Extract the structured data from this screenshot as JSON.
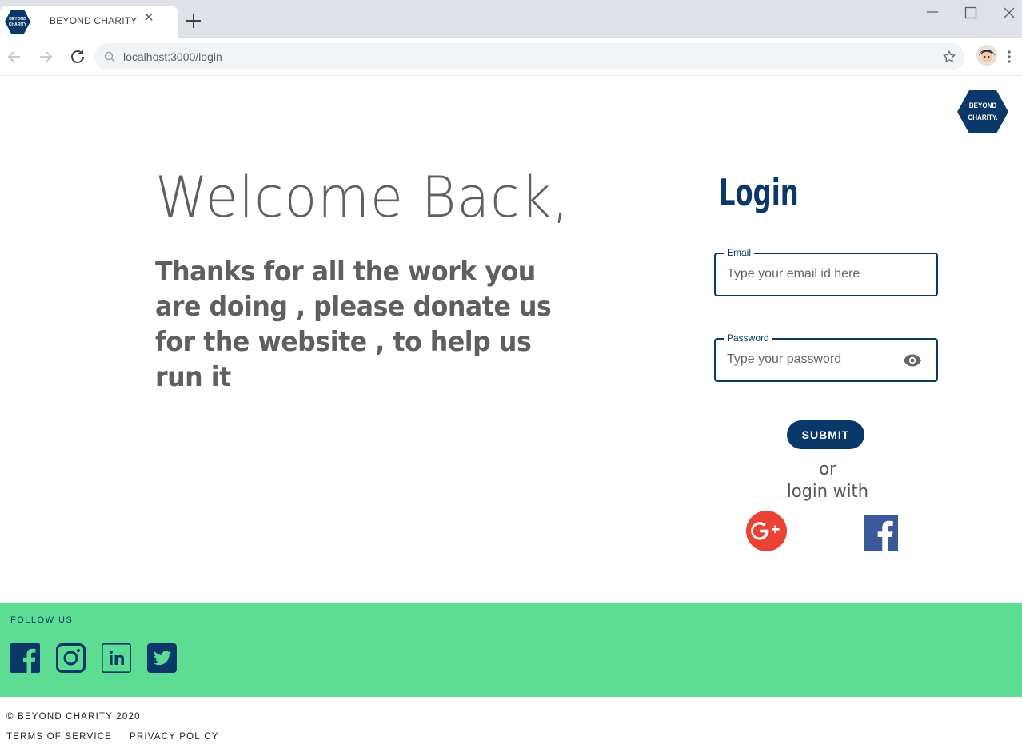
{
  "browser": {
    "tab_title": "BEYOND CHARITY",
    "tab_close": "✕",
    "favicon_text": [
      "BEYOND",
      "CHARITY"
    ],
    "url": "localhost:3000/login"
  },
  "brand": {
    "logo_line1": "BEYOND",
    "logo_line2": "CHARITY."
  },
  "hero": {
    "heading": "Welcome Back,",
    "message": "Thanks for all the work you are doing , please donate us for the website , to help us run it"
  },
  "login": {
    "title": "Login",
    "email_label": "Email",
    "email_placeholder": "Type your email id here",
    "password_label": "Password",
    "password_placeholder": "Type your password",
    "submit_label": "SUBMIT",
    "or_text": "or",
    "login_with_text": "login with"
  },
  "footer": {
    "follow_label": "FOLLOW US",
    "socials": [
      "facebook",
      "instagram",
      "linkedin",
      "twitter"
    ],
    "copyright": "© BEYOND CHARITY 2020",
    "terms": "TERMS OF SERVICE",
    "privacy": "PRIVACY POLICY"
  },
  "colors": {
    "brand_navy": "#0a3868",
    "footer_green": "#5ddd94",
    "text_gray": "#5f5f5f",
    "google_red": "#ea4335",
    "facebook_blue": "#3b5998"
  }
}
